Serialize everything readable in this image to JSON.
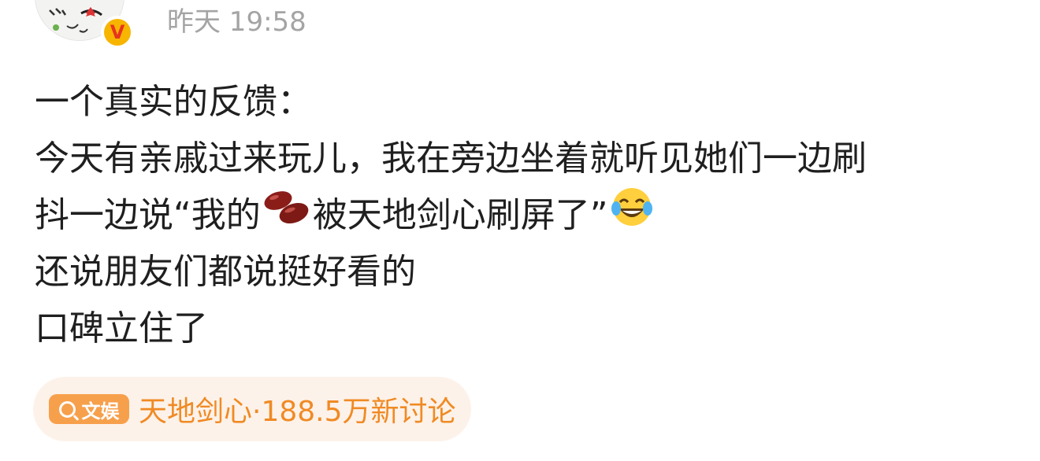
{
  "post": {
    "timestamp": "昨天 19:58",
    "lines": [
      "一个真实的反馈：",
      "今天有亲戚过来玩儿，我在旁边坐着就听见她们一边刷",
      "还说朋友们都说挺好看的",
      "口碑立住了"
    ],
    "line3": {
      "before_emoji": "抖一边说“我的",
      "emoji1_name": "red-bean",
      "after_emoji": "被天地剑心刷屏了”",
      "emoji2_name": "laugh-cry"
    }
  },
  "topic": {
    "tag_label": "文娱",
    "title": "天地剑心·188.5万新讨论"
  },
  "colors": {
    "topic_accent": "#f08a24",
    "topic_bg": "#fdf2e9",
    "timestamp": "#a4a4a4",
    "text": "#1f1f1f",
    "verified_badge": "#f7b500"
  }
}
